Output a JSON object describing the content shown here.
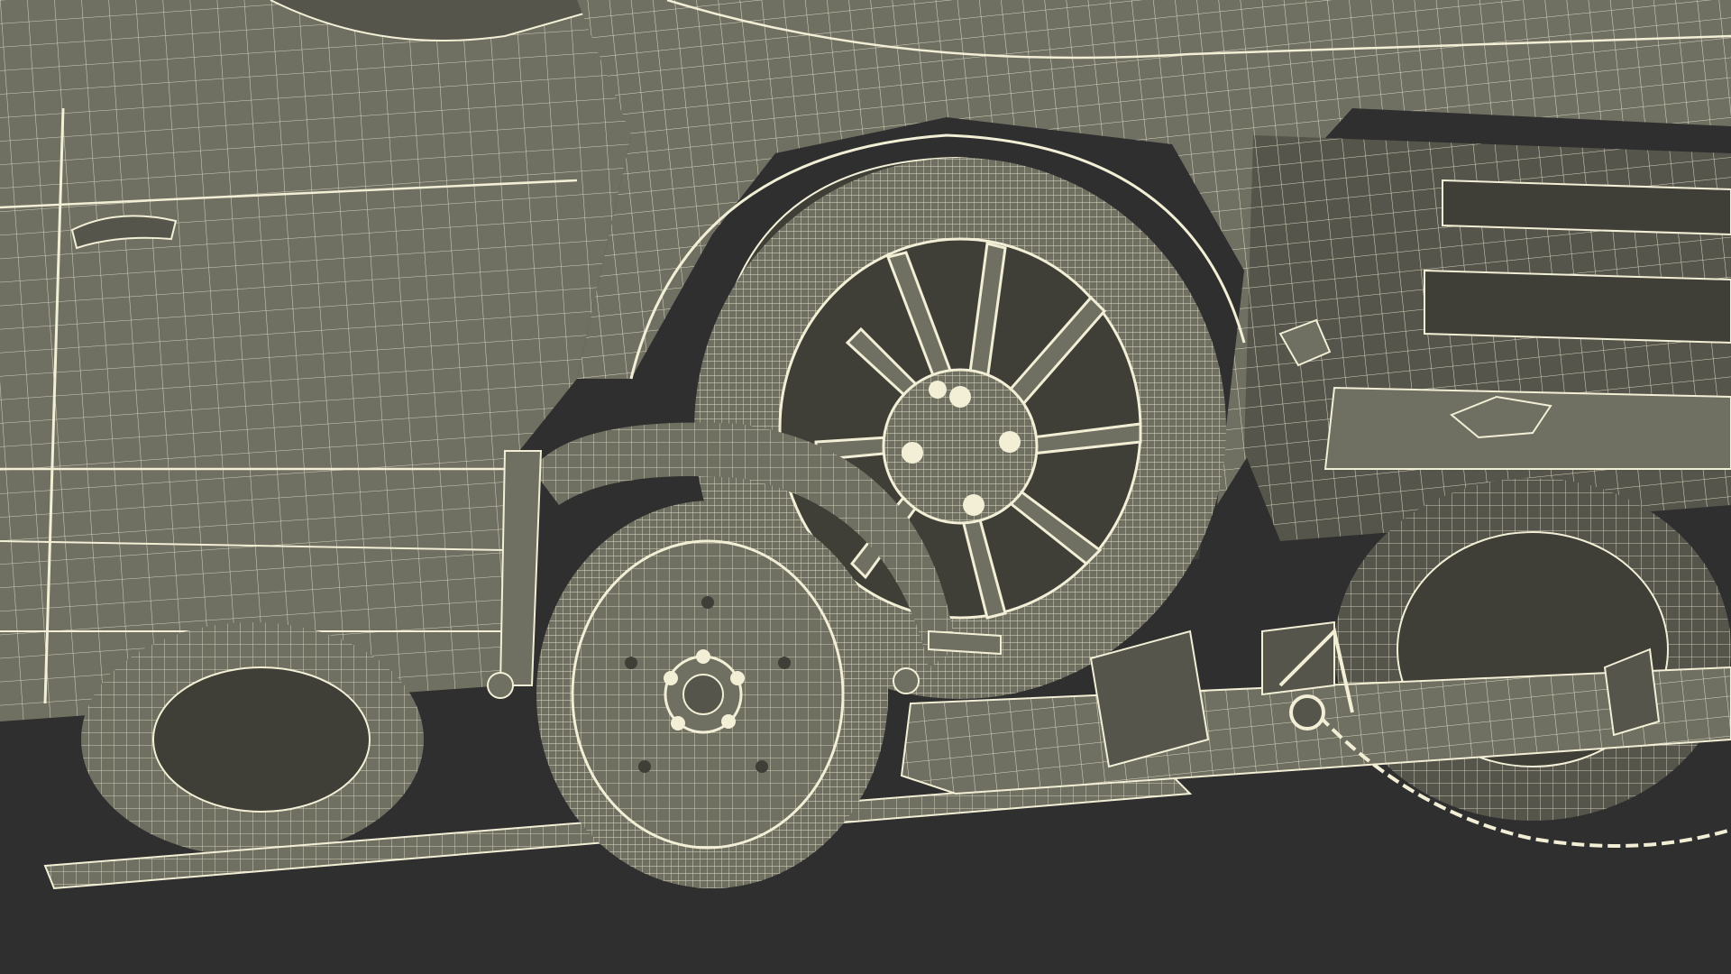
{
  "scene": {
    "subject": "wireframe-render",
    "background_color": "#2f2f2f",
    "surface_color": "#6f6f62",
    "surface_shadow_color": "#55554b",
    "surface_dark_color": "#3f3f38",
    "wire_color": "#f2efd6"
  }
}
